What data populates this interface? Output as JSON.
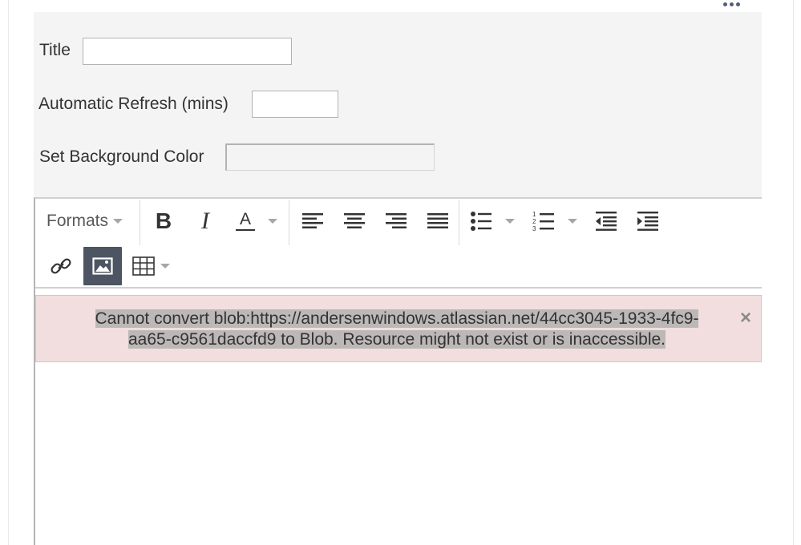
{
  "settings": {
    "title_label": "Title",
    "title_value": "",
    "refresh_label": "Automatic Refresh (mins)",
    "refresh_value": "",
    "bgcolor_label": "Set Background Color",
    "bgcolor_value": ""
  },
  "toolbar": {
    "formats_label": "Formats",
    "bold_glyph": "B",
    "italic_glyph": "I",
    "fontcolor_glyph": "A"
  },
  "notification": {
    "message_line1": "Cannot convert blob:https://andersenwindows.atlassian.net/44cc3045-1933-4fc9-",
    "message_line2": "aa65-c9561daccfd9 to Blob. Resource might not exist or is inaccessible.",
    "close_glyph": "×"
  },
  "icons": {
    "more": "more-icon",
    "link": "link-icon",
    "image": "image-icon",
    "table": "table-icon"
  },
  "colors": {
    "error_bg": "#f2dede",
    "active_button": "#4c5561",
    "panel_bg": "#f4f4f4"
  }
}
